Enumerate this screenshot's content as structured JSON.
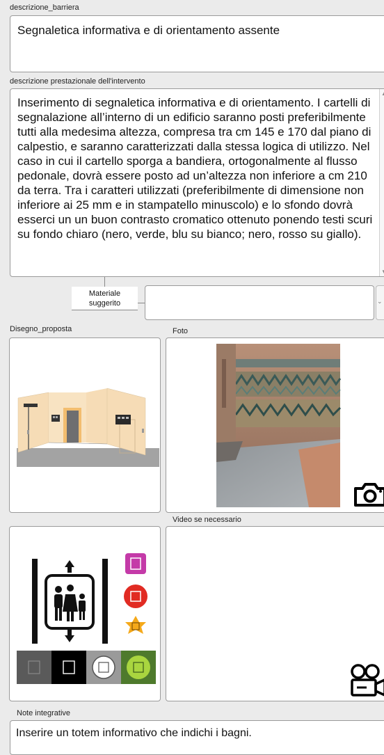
{
  "fields": {
    "descrizione_barriera": {
      "label": "descrizione_barriera",
      "value": "Segnaletica informativa e di orientamento assente"
    },
    "descrizione_prestazionale": {
      "label": "descrizione prestazionale dell'intervento",
      "value": "Inserimento di segnaletica informativa e di orientamento. I cartelli di segnalazione all’interno di un edificio saranno posti preferibilmente tutti alla medesima altezza, compresa tra cm 145 e 170 dal piano di calpestio, e saranno caratterizzati dalla stessa logica di utilizzo. Nel caso in cui il cartello sporga a bandiera, ortogonalmente al flusso pedonale, dovrà essere posto  ad un’altezza non inferiore a cm 210 da terra. Tra i caratteri utilizzati (preferibilmente di dimensione non inferiore ai 25 mm e in stampatello minuscolo) e lo sfondo dovrà esserci un un buon contrasto cromatico ottenuto ponendo testi scuri su fondo chiaro (nero, verde, blu su bianco; nero, rosso su giallo)."
    },
    "materiale": {
      "label_line1": "Materiale",
      "label_line2": "suggerito",
      "value": ""
    },
    "disegno_proposta": {
      "label": "Disegno_proposta"
    },
    "foto": {
      "label": "Foto"
    },
    "video": {
      "label": "Video se necessario"
    },
    "note": {
      "label": "Note integrative",
      "value": "Inserire un totem informativo che indichi i bagni."
    }
  },
  "icons": {
    "camera": "camera-icon",
    "video": "video-camera-icon"
  },
  "colors": {
    "background": "#ebebeb",
    "field_border": "#9a9a9a",
    "wall": "#f6dcb6",
    "floor": "#9e9e9e",
    "door": "#f2bd6f"
  }
}
